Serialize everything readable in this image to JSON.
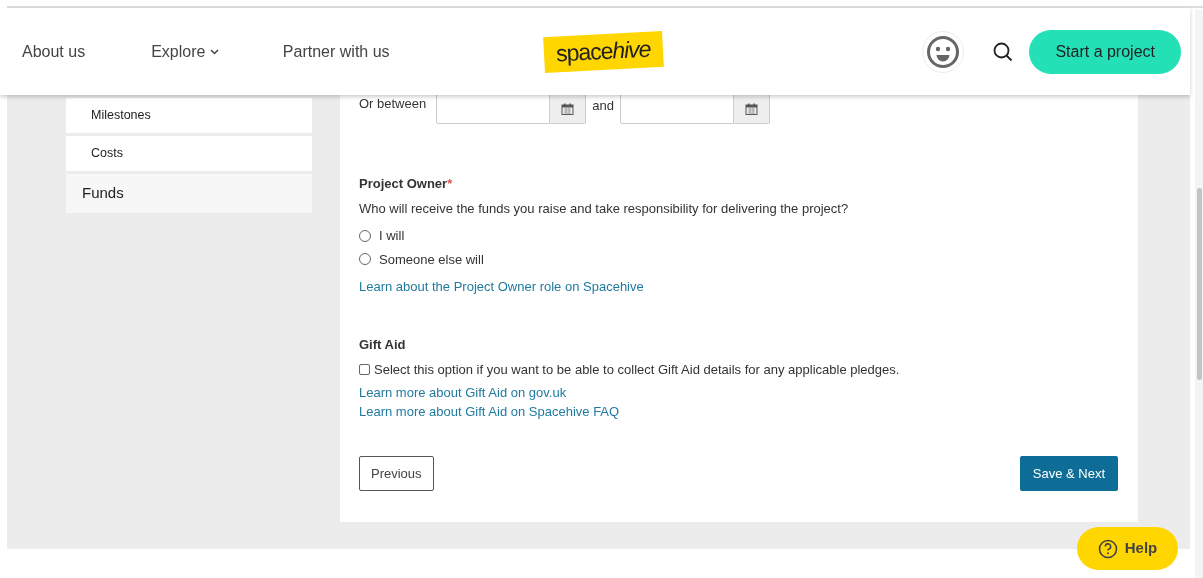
{
  "header": {
    "nav": [
      {
        "label": "About us",
        "kind": "link"
      },
      {
        "label": "Explore",
        "kind": "dropdown"
      },
      {
        "label": "Partner with us",
        "kind": "link"
      }
    ],
    "logo": {
      "text": "space",
      "emphasis": "hive"
    },
    "cta": "Start a project"
  },
  "sidebar": {
    "items": [
      {
        "label": "Milestones",
        "kind": "sub"
      },
      {
        "label": "Costs",
        "kind": "sub"
      },
      {
        "label": "Funds",
        "kind": "main"
      }
    ]
  },
  "date_range": {
    "label": "Or between",
    "joiner": "and"
  },
  "project_owner": {
    "title": "Project Owner",
    "required_mark": "*",
    "question": "Who will receive the funds you raise and take responsibility for delivering the project?",
    "options": [
      {
        "label": "I will",
        "selected": false
      },
      {
        "label": "Someone else will",
        "selected": false
      }
    ],
    "link": "Learn about the Project Owner role on Spacehive"
  },
  "gift_aid": {
    "title": "Gift Aid",
    "checked": false,
    "label": "Select this option if you want to be able to collect Gift Aid details for any applicable pledges.",
    "links": [
      "Learn more about Gift Aid on gov.uk",
      "Learn more about Gift Aid on Spacehive FAQ"
    ]
  },
  "buttons": {
    "previous": "Previous",
    "next": "Save & Next"
  },
  "help": "Help"
}
